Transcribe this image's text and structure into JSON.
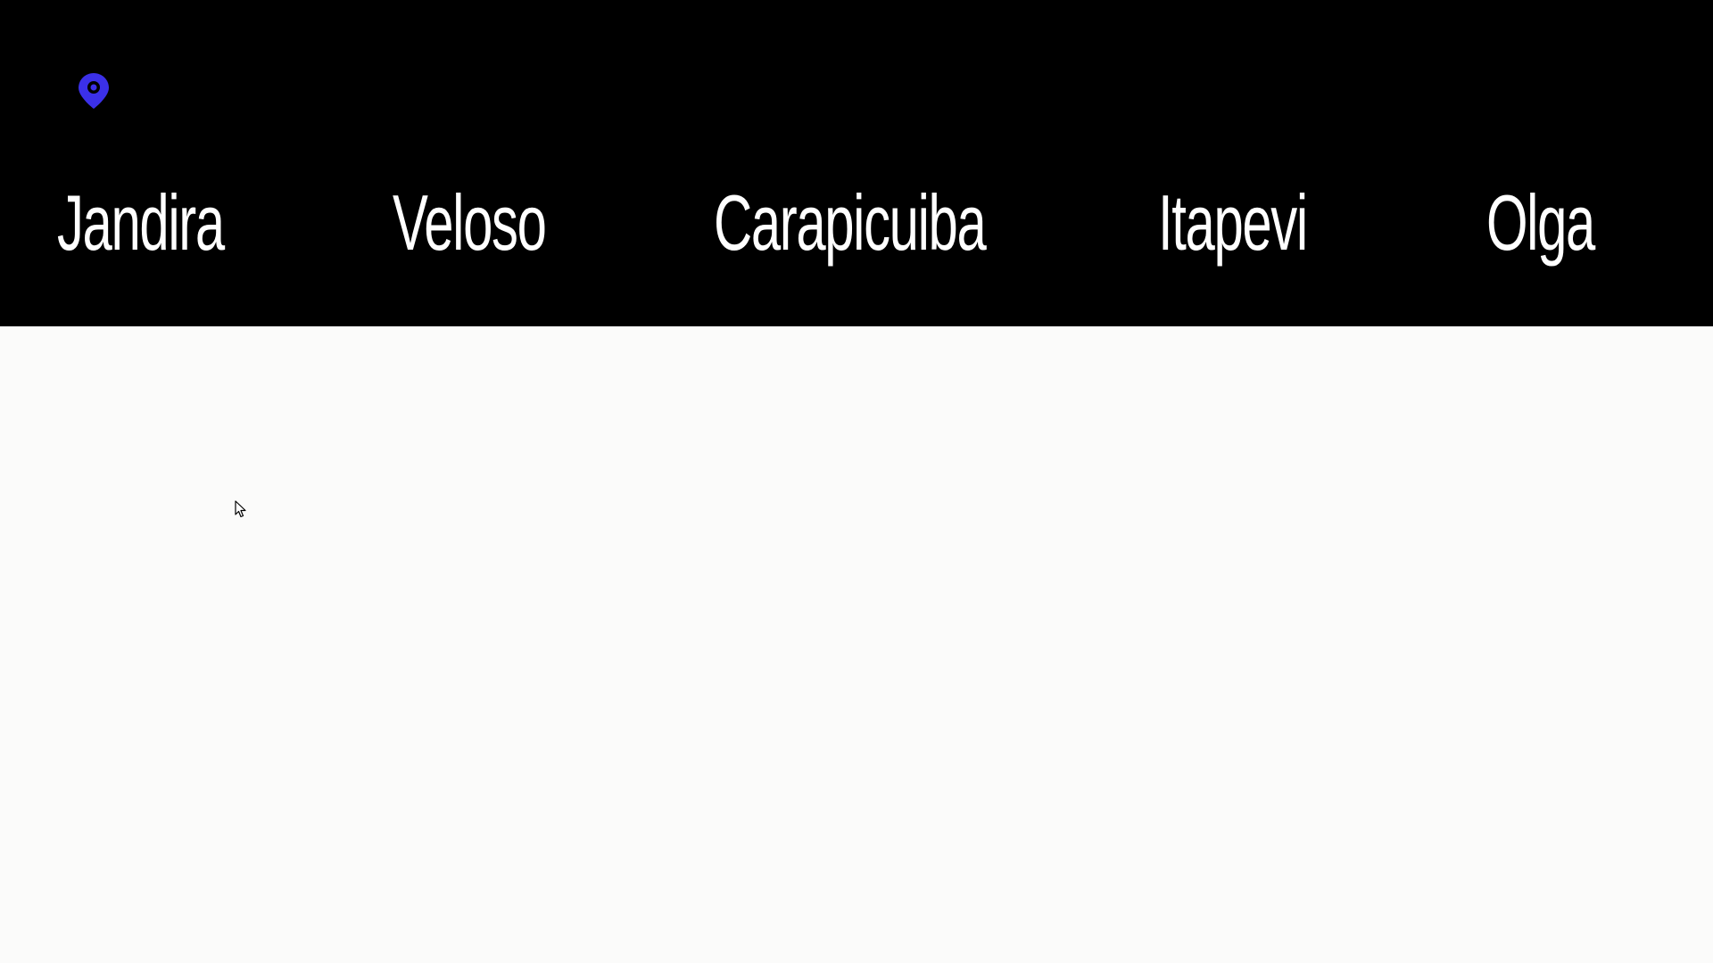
{
  "header": {
    "background": "#000000",
    "pin_icon": "map-pin-icon",
    "pin_color": "#3b30e8"
  },
  "nav": {
    "items": [
      {
        "label": "Jandira"
      },
      {
        "label": "Veloso"
      },
      {
        "label": "Carapicuiba"
      },
      {
        "label": "Itapevi"
      },
      {
        "label": "Olga"
      }
    ],
    "text_color": "#ffffff"
  },
  "main": {
    "background": "#fbfbfa",
    "cursor_icon": "mouse-pointer-icon"
  }
}
